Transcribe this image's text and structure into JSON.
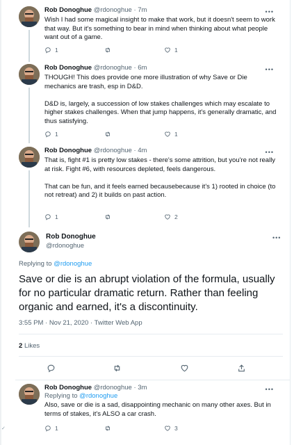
{
  "tweets": [
    {
      "name": "Rob Donoghue",
      "handle": "@rdonoghue",
      "time": "7m",
      "text": [
        "Wish I had some magical insight to make that work, but it doesn't seem to work that way.  But it's something to bear in mind when thinking about what people want out of a game."
      ],
      "replies": "1",
      "retweets": "",
      "likes": "1"
    },
    {
      "name": "Rob Donoghue",
      "handle": "@rdonoghue",
      "time": "6m",
      "text": [
        "THOUGH!  This does provide one more illustration of why Save or Die mechanics are trash, esp in D&D.",
        "D&D is, largely, a succession of low stakes challenges which may escalate to higher stakes challenges.  When that jump happens, it's generally dramatic, and thus satisfying."
      ],
      "replies": "1",
      "retweets": "",
      "likes": "1"
    },
    {
      "name": "Rob Donoghue",
      "handle": "@rdonoghue",
      "time": "4m",
      "text": [
        "That is, fight #1 is pretty low stakes - there's some attrition, but you're not really at risk.  Fight #6, with resources depleted, feels dangerous.",
        "That can be fun, and it feels earned becausebecause it's 1) rooted in choice (to not retreat) and 2) it builds on past action."
      ],
      "replies": "1",
      "retweets": "",
      "likes": "2"
    }
  ],
  "main_tweet": {
    "name": "Rob Donoghue",
    "handle": "@rdonoghue",
    "replying_prefix": "Replying to",
    "replying_to": "@rdonoghue",
    "text": "Save or die is an abrupt violation of the formula, usually for no particular dramatic return.  Rather than feeling organic and earned, it's a discontinuity.",
    "meta": "3:55 PM · Nov 21, 2020 · Twitter Web App",
    "likes_count": "2",
    "likes_label": "Likes"
  },
  "last_tweet": {
    "name": "Rob Donoghue",
    "handle": "@rdonoghue",
    "time": "3m",
    "replying_prefix": "Replying to",
    "replying_to": "@rdonoghue",
    "text": "Also, save or die is a sad, disappointing mechanic on many other axes.  But in terms of stakes, it's ALSO a car crash.",
    "replies": "1",
    "retweets": "",
    "likes": "3"
  },
  "ui": {
    "more": "•••",
    "dot": "·",
    "corner_mark": "✓"
  },
  "colors": {
    "accent": "#1d9bf0",
    "text": "#0f1419",
    "muted": "#536471",
    "divider": "#e6ecf0"
  },
  "icons": [
    "reply-icon",
    "retweet-icon",
    "like-icon",
    "share-icon",
    "more-icon",
    "avatar"
  ]
}
